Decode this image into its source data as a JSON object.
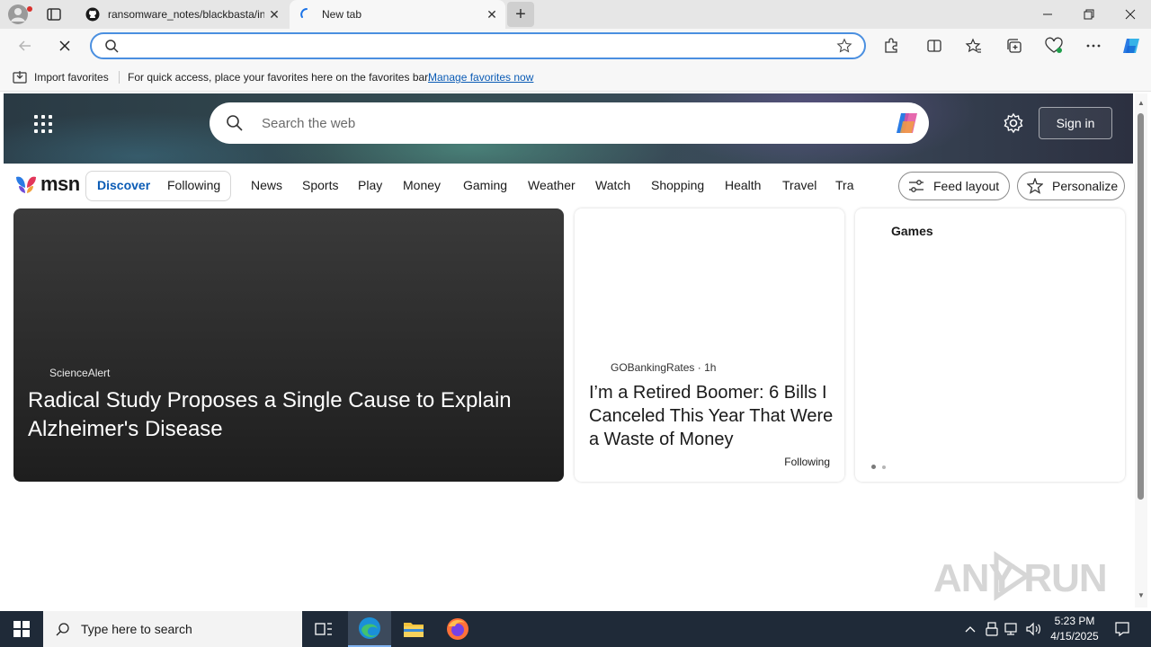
{
  "browser": {
    "tabs": [
      {
        "title": "ransomware_notes/blackbasta/in",
        "icon": "github-icon",
        "active": false
      },
      {
        "title": "New tab",
        "icon": "loading-icon",
        "active": true
      }
    ],
    "address": {
      "value": "",
      "placeholder": ""
    },
    "favorites_bar": {
      "import_label": "Import favorites",
      "message": "For quick access, place your favorites here on the favorites bar.",
      "link": "Manage favorites now"
    }
  },
  "msn": {
    "search_placeholder": "Search the web",
    "sign_in": "Sign in",
    "logo_text": "msn",
    "feed_tabs": [
      "Discover",
      "Following"
    ],
    "nav_items": [
      "News",
      "Sports",
      "Play",
      "Money",
      "Gaming",
      "Weather",
      "Watch",
      "Shopping",
      "Health",
      "Travel",
      "Tra"
    ],
    "feed_layout": "Feed layout",
    "personalize": "Personalize",
    "cards": {
      "hero": {
        "source": "ScienceAlert",
        "title": "Radical Study Proposes a Single Cause to Explain Alzheimer's Disease"
      },
      "middle": {
        "source": "GOBankingRates",
        "age": "1h",
        "title": "I’m a Retired Boomer: 6 Bills I Canceled This Year That Were a Waste of Money",
        "follow_label": "Following"
      },
      "games": {
        "header": "Games"
      }
    }
  },
  "watermark": "ANY RUN",
  "taskbar": {
    "search_placeholder": "Type here to search",
    "time": "5:23 PM",
    "date": "4/15/2025"
  },
  "colors": {
    "accent": "#0a5bb5",
    "address_focus": "#4a8fe0",
    "taskbar": "#1f2a38"
  }
}
